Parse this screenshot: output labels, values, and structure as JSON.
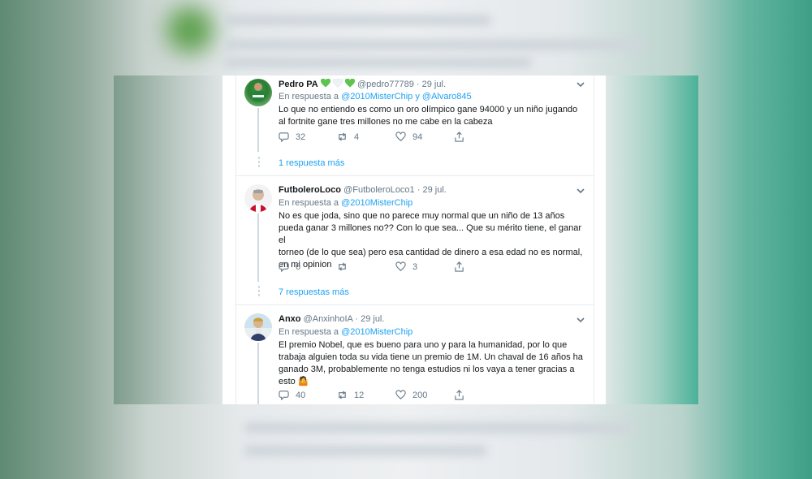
{
  "tweets": [
    {
      "name": "Pedro PA",
      "emoji_hearts": [
        "green-heart",
        "white-heart",
        "green-heart"
      ],
      "handle": "@pedro77789",
      "sep": "·",
      "date": "29 jul.",
      "reply_prefix": "En respuesta a",
      "reply_to_1": "@2010MisterChip",
      "reply_joiner": "y",
      "reply_to_2": "@Alvaro845",
      "text_line1": "Lo que no entiendo es como un oro olímpico gane 94000 y un niño jugando",
      "text_line2": "al fortnite gane  tres millones no me cabe en la cabeza",
      "replies": "32",
      "retweets": "4",
      "likes": "94",
      "more_replies": "1 respuesta más"
    },
    {
      "name": "FutboleroLoco",
      "handle": "@FutboleroLoco1",
      "sep": "·",
      "date": "29 jul.",
      "reply_prefix": "En respuesta a",
      "reply_to_1": "@2010MisterChip",
      "text_line1": "No es que joda, sino que no parece muy normal que un niño de 13 años",
      "text_line2": "pueda ganar 3 millones no?? Con lo que sea... Que su mérito tiene, el ganar el",
      "text_line3": "torneo (de lo que sea) pero esa cantidad de dinero a esa edad no es normal,",
      "text_line4": "en mi opinion",
      "replies": "6",
      "retweets": "",
      "likes": "3",
      "more_replies": "7 respuestas más"
    },
    {
      "name": "Anxo",
      "handle": "@AnxinhoIA",
      "sep": "·",
      "date": "29 jul.",
      "reply_prefix": "En respuesta a",
      "reply_to_1": "@2010MisterChip",
      "text_line1": "El premio Nobel, que es bueno para uno y para la humanidad, por lo que",
      "text_line2": "trabaja alguien toda su vida tiene un premio de 1M. Un chaval de 16 años ha",
      "text_line3": "ganado 3M, probablemente no tenga estudios ni los vaya a tener gracias a",
      "text_line4": "esto",
      "text_emoji": "🤷",
      "replies": "40",
      "retweets": "12",
      "likes": "200"
    }
  ],
  "colors": {
    "link": "#1da1f2",
    "secondary_text": "#657786",
    "primary_text": "#14171a",
    "heart_green": "#5ec44f",
    "heart_white": "#e9eef2"
  }
}
